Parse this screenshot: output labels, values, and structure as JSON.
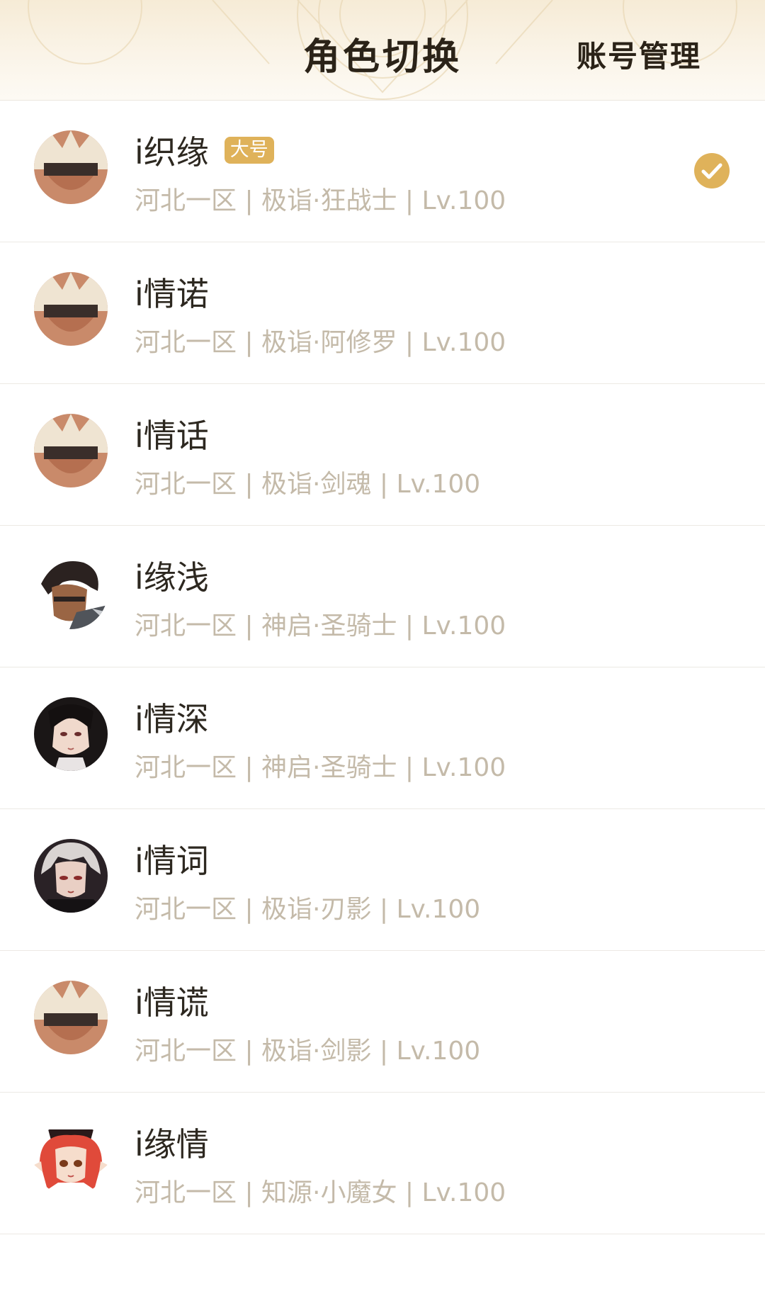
{
  "header": {
    "title": "角色切换",
    "account_action": "账号管理"
  },
  "colors": {
    "accent": "#dfb25a",
    "text_primary": "#2d2820",
    "text_secondary": "#c4baa9"
  },
  "roles": [
    {
      "name": "i织缘",
      "badge": "大号",
      "meta": "河北一区 | 极诣·狂战士 | Lv.100",
      "selected": true,
      "avatar_icon": "white-hair-warrior-avatar"
    },
    {
      "name": "i情诺",
      "badge": "",
      "meta": "河北一区 | 极诣·阿修罗 | Lv.100",
      "selected": false,
      "avatar_icon": "white-hair-warrior-avatar"
    },
    {
      "name": "i情话",
      "badge": "",
      "meta": "河北一区 | 极诣·剑魂 | Lv.100",
      "selected": false,
      "avatar_icon": "white-hair-warrior-avatar"
    },
    {
      "name": "i缘浅",
      "badge": "",
      "meta": "河北一区 | 神启·圣骑士 | Lv.100",
      "selected": false,
      "avatar_icon": "dark-hair-priest-avatar"
    },
    {
      "name": "i情深",
      "badge": "",
      "meta": "河北一区 | 神启·圣骑士 | Lv.100",
      "selected": false,
      "avatar_icon": "black-hair-woman-avatar"
    },
    {
      "name": "i情词",
      "badge": "",
      "meta": "河北一区 | 极诣·刃影 | Lv.100",
      "selected": false,
      "avatar_icon": "silver-hair-assassin-avatar"
    },
    {
      "name": "i情谎",
      "badge": "",
      "meta": "河北一区 | 极诣·剑影 | Lv.100",
      "selected": false,
      "avatar_icon": "white-hair-warrior-avatar"
    },
    {
      "name": "i缘情",
      "badge": "",
      "meta": "河北一区 | 知源·小魔女 | Lv.100",
      "selected": false,
      "avatar_icon": "red-hair-witch-avatar"
    }
  ]
}
